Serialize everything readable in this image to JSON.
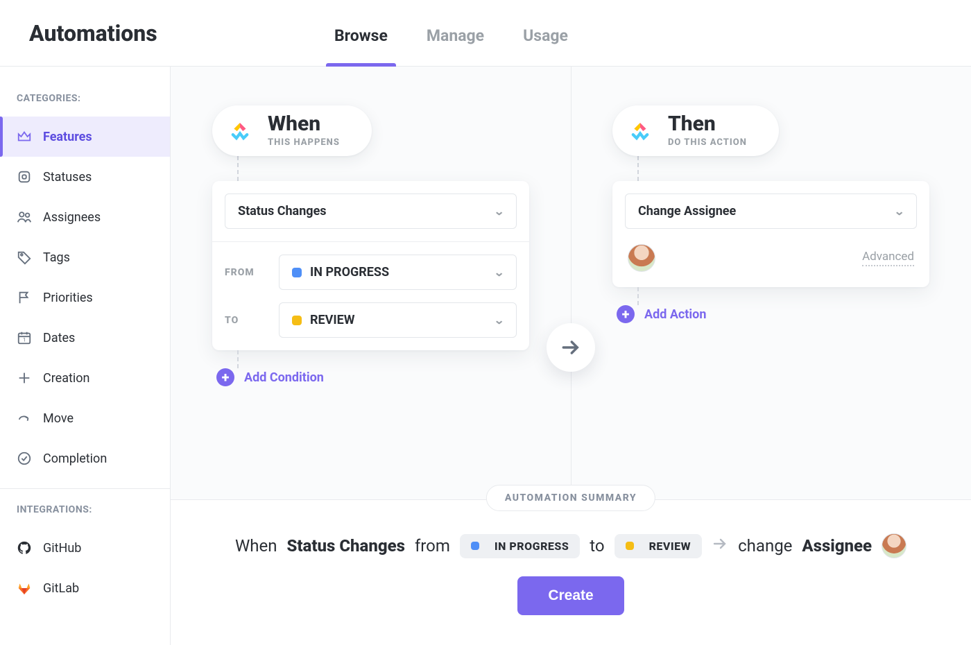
{
  "header": {
    "title": "Automations",
    "tabs": [
      {
        "label": "Browse",
        "active": true
      },
      {
        "label": "Manage",
        "active": false
      },
      {
        "label": "Usage",
        "active": false
      }
    ]
  },
  "sidebar": {
    "categories_label": "CATEGORIES:",
    "integrations_label": "INTEGRATIONS:",
    "items": [
      {
        "label": "Features",
        "icon": "crown"
      },
      {
        "label": "Statuses",
        "icon": "status"
      },
      {
        "label": "Assignees",
        "icon": "people"
      },
      {
        "label": "Tags",
        "icon": "tag"
      },
      {
        "label": "Priorities",
        "icon": "flag"
      },
      {
        "label": "Dates",
        "icon": "calendar"
      },
      {
        "label": "Creation",
        "icon": "plus"
      },
      {
        "label": "Move",
        "icon": "arrow"
      },
      {
        "label": "Completion",
        "icon": "check"
      }
    ],
    "integrations": [
      {
        "label": "GitHub",
        "icon": "github"
      },
      {
        "label": "GitLab",
        "icon": "gitlab"
      }
    ]
  },
  "builder": {
    "when": {
      "title": "When",
      "subtitle": "THIS HAPPENS",
      "trigger": "Status Changes",
      "from_label": "FROM",
      "from_value": "IN PROGRESS",
      "from_color": "#4f8ff7",
      "to_label": "TO",
      "to_value": "REVIEW",
      "to_color": "#f5bd15",
      "add_label": "Add Condition"
    },
    "then": {
      "title": "Then",
      "subtitle": "DO THIS ACTION",
      "action": "Change Assignee",
      "advanced_label": "Advanced",
      "add_label": "Add Action"
    }
  },
  "summary": {
    "pill": "AUTOMATION SUMMARY",
    "when_word": "When",
    "trigger_bold": "Status Changes",
    "from_word": "from",
    "from_chip": "IN PROGRESS",
    "to_word": "to",
    "to_chip": "REVIEW",
    "change_word": "change",
    "assignee_bold": "Assignee",
    "create_label": "Create"
  }
}
